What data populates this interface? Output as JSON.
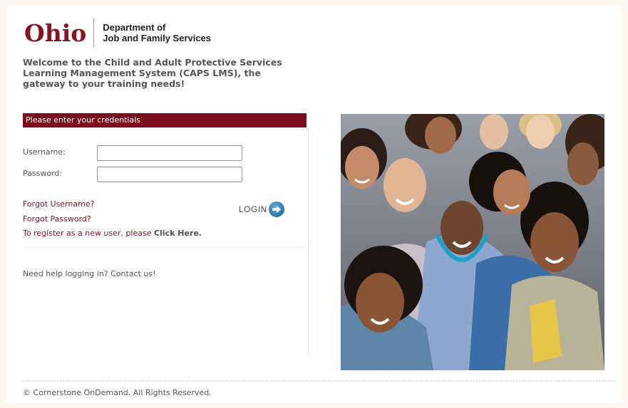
{
  "header": {
    "logo_word": "Ohio",
    "dept_line1": "Department of",
    "dept_line2": "Job and Family Services",
    "welcome": "Welcome to the Child and Adult Protective Services Learning Management System (CAPS LMS), the gateway to your training needs!"
  },
  "login": {
    "panel_title": "Please enter your credentials",
    "username_label": "Username:",
    "username_value": "",
    "password_label": "Password:",
    "password_value": "",
    "login_label": "LOGIN",
    "forgot_username": "Forgot Username?",
    "forgot_password": "Forgot Password?",
    "register_prefix": "To register as a new user, please ",
    "register_link": "Click Here.",
    "help_prefix": "Need help logging in? ",
    "help_link": "Contact us!"
  },
  "footer": {
    "copyright": "© Cornerstone OnDemand. All Rights Reserved."
  },
  "colors": {
    "brand_maroon": "#7a0e1c",
    "link": "#7a1424",
    "login_icon": "#2a77ad"
  },
  "icons": {
    "login": "arrow-circle-icon"
  }
}
